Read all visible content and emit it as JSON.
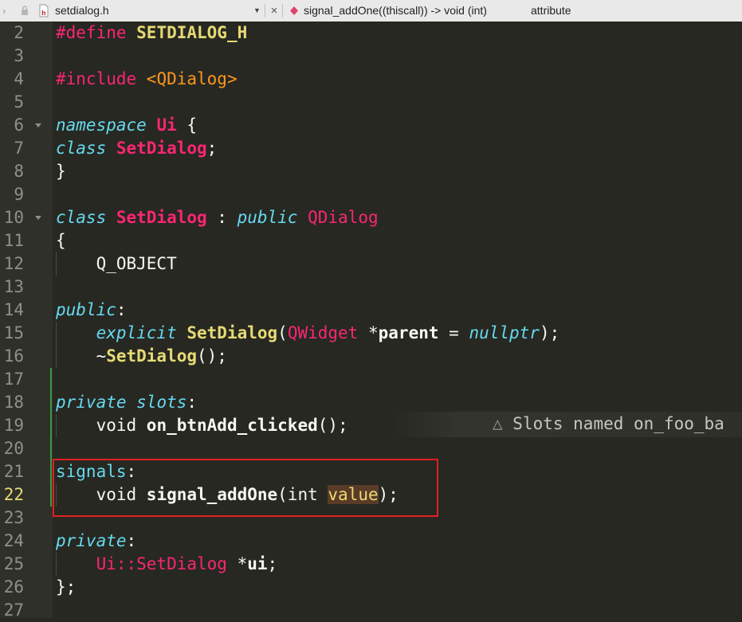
{
  "tabbar": {
    "file_name": "setdialog.h",
    "symbol_text": "signal_addOne((thiscall)) -> void (int)",
    "attribute_label": "attribute"
  },
  "warning": {
    "text": "Slots named on_foo_ba"
  },
  "lines": [
    {
      "n": "2",
      "parts": [
        {
          "t": "#define ",
          "c": "prep"
        },
        {
          "t": "SETDIALOG_H",
          "c": "fn"
        }
      ]
    },
    {
      "n": "3",
      "parts": []
    },
    {
      "n": "4",
      "parts": [
        {
          "t": "#include ",
          "c": "prep"
        },
        {
          "t": "<QDialog>",
          "c": "str"
        }
      ]
    },
    {
      "n": "5",
      "parts": []
    },
    {
      "n": "6",
      "parts": [
        {
          "t": "namespace ",
          "c": "kw"
        },
        {
          "t": "Ui",
          "c": "cls"
        },
        {
          "t": " {",
          "c": "pun"
        }
      ],
      "fold": true
    },
    {
      "n": "7",
      "parts": [
        {
          "t": "class ",
          "c": "kw"
        },
        {
          "t": "SetDialog",
          "c": "cls"
        },
        {
          "t": ";",
          "c": "pun"
        }
      ]
    },
    {
      "n": "8",
      "parts": [
        {
          "t": "}",
          "c": "pun"
        }
      ]
    },
    {
      "n": "9",
      "parts": []
    },
    {
      "n": "10",
      "parts": [
        {
          "t": "class ",
          "c": "kw"
        },
        {
          "t": "SetDialog",
          "c": "cls"
        },
        {
          "t": " : ",
          "c": "pun"
        },
        {
          "t": "public ",
          "c": "kw"
        },
        {
          "t": "QDialog",
          "c": "typ"
        }
      ],
      "fold": true
    },
    {
      "n": "11",
      "parts": [
        {
          "t": "{",
          "c": "pun"
        }
      ]
    },
    {
      "n": "12",
      "parts": [
        {
          "t": "    Q_OBJECT",
          "c": "pun"
        }
      ]
    },
    {
      "n": "13",
      "parts": []
    },
    {
      "n": "14",
      "parts": [
        {
          "t": "public",
          "c": "kw"
        },
        {
          "t": ":",
          "c": "pun"
        }
      ]
    },
    {
      "n": "15",
      "parts": [
        {
          "t": "    ",
          "c": "pun"
        },
        {
          "t": "explicit ",
          "c": "kw"
        },
        {
          "t": "SetDialog",
          "c": "fn"
        },
        {
          "t": "(",
          "c": "pun"
        },
        {
          "t": "QWidget ",
          "c": "typ"
        },
        {
          "t": "*",
          "c": "pun"
        },
        {
          "t": "parent",
          "c": "fnw"
        },
        {
          "t": " = ",
          "c": "pun"
        },
        {
          "t": "nullptr",
          "c": "kw"
        },
        {
          "t": ");",
          "c": "pun"
        }
      ]
    },
    {
      "n": "16",
      "parts": [
        {
          "t": "    ~",
          "c": "pun"
        },
        {
          "t": "SetDialog",
          "c": "fn"
        },
        {
          "t": "();",
          "c": "pun"
        }
      ]
    },
    {
      "n": "17",
      "parts": []
    },
    {
      "n": "18",
      "parts": [
        {
          "t": "private ",
          "c": "kw"
        },
        {
          "t": "slots",
          "c": "kw"
        },
        {
          "t": ":",
          "c": "pun"
        }
      ]
    },
    {
      "n": "19",
      "parts": [
        {
          "t": "    ",
          "c": "pun"
        },
        {
          "t": "void ",
          "c": "pun"
        },
        {
          "t": "on_btnAdd_clicked",
          "c": "fnw"
        },
        {
          "t": "();",
          "c": "pun"
        }
      ]
    },
    {
      "n": "20",
      "parts": []
    },
    {
      "n": "21",
      "parts": [
        {
          "t": "signals",
          "c": "kwn"
        },
        {
          "t": ":",
          "c": "pun"
        }
      ]
    },
    {
      "n": "22",
      "parts": [
        {
          "t": "    ",
          "c": "pun"
        },
        {
          "t": "void ",
          "c": "pun"
        },
        {
          "t": "signal_addOne",
          "c": "fnw"
        },
        {
          "t": "(",
          "c": "pun"
        },
        {
          "t": "int ",
          "c": "pun"
        },
        {
          "t": "value",
          "c": "param"
        },
        {
          "t": ");",
          "c": "pun"
        }
      ],
      "current": true
    },
    {
      "n": "23",
      "parts": []
    },
    {
      "n": "24",
      "parts": [
        {
          "t": "private",
          "c": "kw"
        },
        {
          "t": ":",
          "c": "pun"
        }
      ]
    },
    {
      "n": "25",
      "parts": [
        {
          "t": "    ",
          "c": "pun"
        },
        {
          "t": "Ui::SetDialog ",
          "c": "typ"
        },
        {
          "t": "*",
          "c": "pun"
        },
        {
          "t": "ui",
          "c": "fnw"
        },
        {
          "t": ";",
          "c": "pun"
        }
      ]
    },
    {
      "n": "26",
      "parts": [
        {
          "t": "};",
          "c": "pun"
        }
      ]
    },
    {
      "n": "27",
      "parts": []
    }
  ]
}
